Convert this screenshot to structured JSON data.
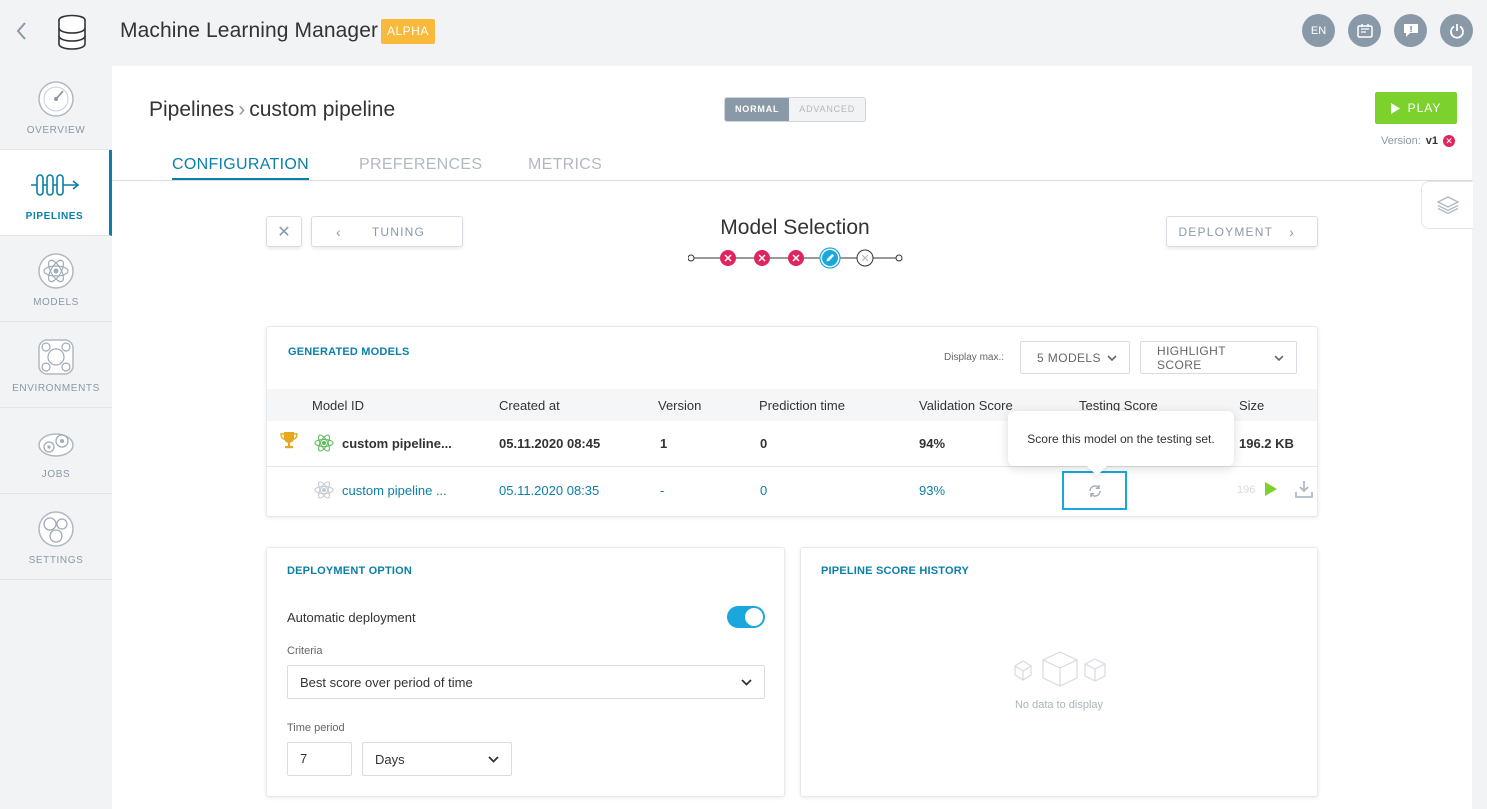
{
  "header": {
    "title": "Machine Learning Manager",
    "badge": "ALPHA",
    "lang": "EN",
    "icons": [
      "back-icon",
      "database-logo-icon",
      "language-icon",
      "news-icon",
      "feedback-icon",
      "power-icon"
    ]
  },
  "sidebar": {
    "items": [
      {
        "label": "OVERVIEW",
        "icon": "gauge-icon",
        "active": false
      },
      {
        "label": "PIPELINES",
        "icon": "pipeline-icon",
        "active": true
      },
      {
        "label": "MODELS",
        "icon": "atom-icon",
        "active": false
      },
      {
        "label": "ENVIRONMENTS",
        "icon": "environment-icon",
        "active": false
      },
      {
        "label": "JOBS",
        "icon": "gears-icon",
        "active": false
      },
      {
        "label": "SETTINGS",
        "icon": "settings-gear-icon",
        "active": false
      }
    ]
  },
  "breadcrumb": {
    "root": "Pipelines",
    "current": "custom pipeline"
  },
  "mode": {
    "normal": "NORMAL",
    "advanced": "ADVANCED",
    "selected": "NORMAL"
  },
  "play": {
    "label": "PLAY"
  },
  "version": {
    "label": "Version:",
    "value": "v1"
  },
  "tabs": [
    {
      "label": "CONFIGURATION",
      "active": true
    },
    {
      "label": "PREFERENCES",
      "active": false
    },
    {
      "label": "METRICS",
      "active": false
    }
  ],
  "wizard": {
    "prev_label": "TUNING",
    "next_label": "DEPLOYMENT",
    "title": "Model Selection",
    "steps": [
      "error",
      "error",
      "error",
      "current",
      "pending"
    ]
  },
  "generated_models": {
    "title": "GENERATED MODELS",
    "display_max_label": "Display max.:",
    "models_dropdown": "5 MODELS",
    "highlight_dropdown": "HIGHLIGHT SCORE",
    "columns": [
      "Model ID",
      "Created at",
      "Version",
      "Prediction time",
      "Validation Score",
      "Testing Score",
      "Size"
    ],
    "rows": [
      {
        "model_id": "custom pipeline...",
        "created_at": "05.11.2020 08:45",
        "version": "1",
        "prediction_time": "0",
        "validation_score": "94%",
        "testing_score": "",
        "size": "196.2 KB",
        "best": true
      },
      {
        "model_id": "custom pipeline ...",
        "created_at": "05.11.2020 08:35",
        "version": "-",
        "prediction_time": "0",
        "validation_score": "93%",
        "testing_score": "",
        "size": "196",
        "best": false
      }
    ],
    "tooltip": "Score this model on the testing set."
  },
  "deployment_option": {
    "title": "DEPLOYMENT OPTION",
    "auto_label": "Automatic deployment",
    "auto_enabled": true,
    "criteria_label": "Criteria",
    "criteria_value": "Best score over period of time",
    "time_period_label": "Time period",
    "time_period_value": "7",
    "time_unit": "Days"
  },
  "score_history": {
    "title": "PIPELINE SCORE HISTORY",
    "empty_text": "No data to display"
  },
  "colors": {
    "accent": "#0a7fa8",
    "play": "#7dd12c",
    "error": "#e0245e",
    "badge": "#f9b93a",
    "highlight": "#1aa7dc"
  }
}
